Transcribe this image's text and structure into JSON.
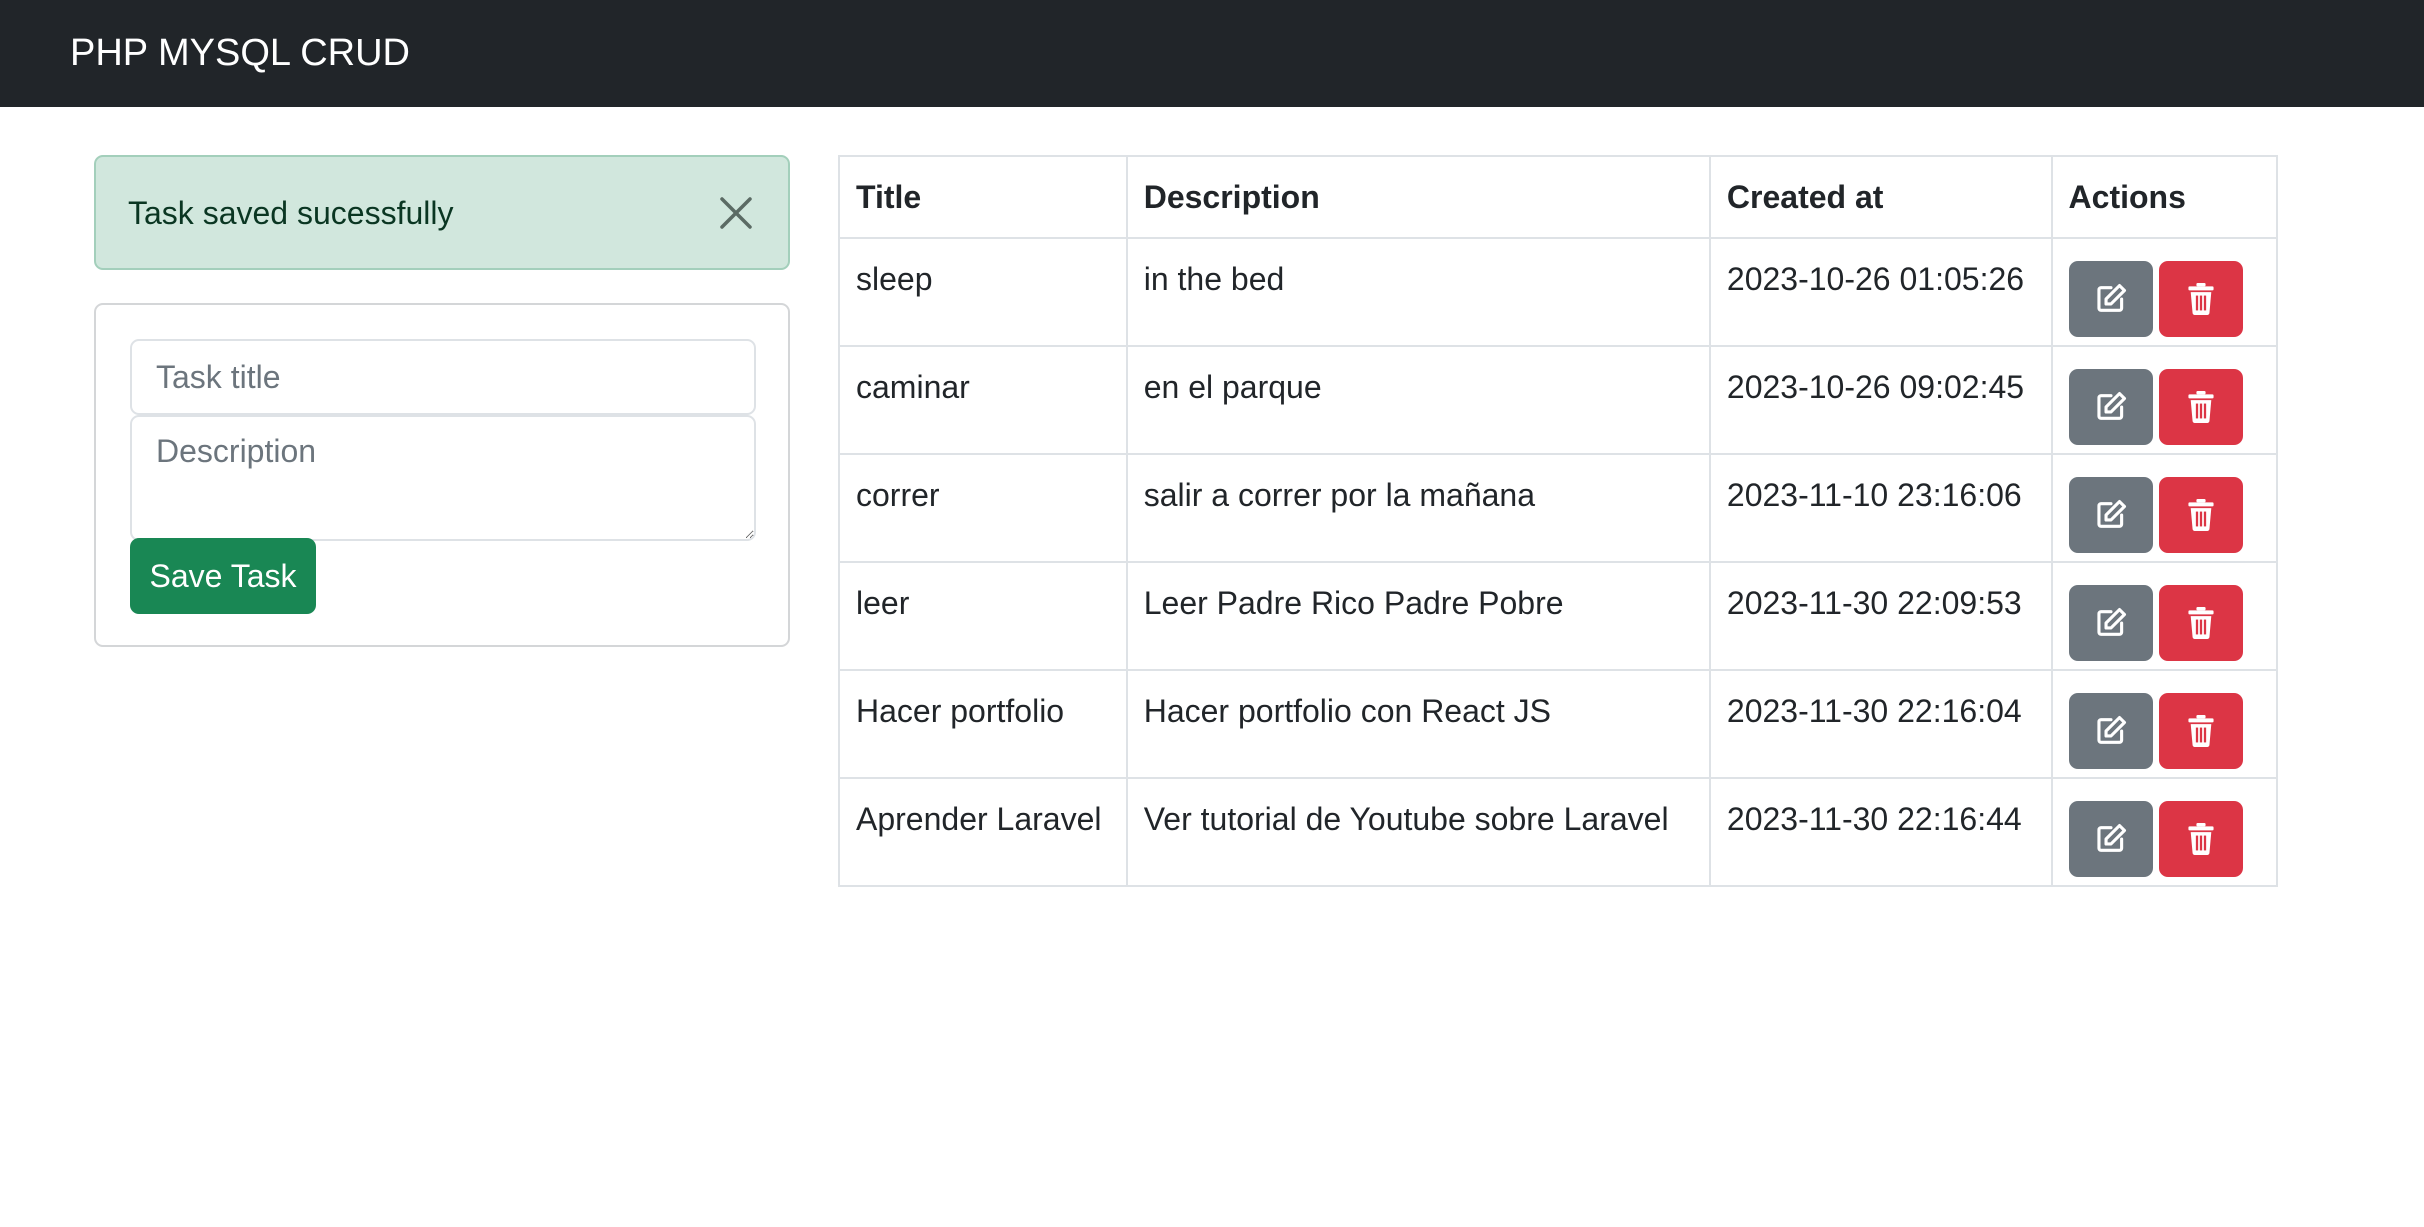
{
  "navbar": {
    "brand": "PHP MYSQL CRUD"
  },
  "alert": {
    "message": "Task saved sucessfully",
    "close_icon": "close-icon",
    "color": "#d1e7dd"
  },
  "form": {
    "title_placeholder": "Task title",
    "title_value": "",
    "description_placeholder": "Description",
    "description_value": "",
    "save_label": "Save Task",
    "save_color": "#198754"
  },
  "table": {
    "headers": {
      "title": "Title",
      "description": "Description",
      "created_at": "Created at",
      "actions": "Actions"
    },
    "rows": [
      {
        "title": "sleep",
        "description": "in the bed",
        "created_at": "2023-10-26 01:05:26"
      },
      {
        "title": "caminar",
        "description": "en el parque",
        "created_at": "2023-10-26 09:02:45"
      },
      {
        "title": "correr",
        "description": "salir a correr por la mañana",
        "created_at": "2023-11-10 23:16:06"
      },
      {
        "title": "leer",
        "description": "Leer Padre Rico Padre Pobre",
        "created_at": "2023-11-30 22:09:53"
      },
      {
        "title": "Hacer portfolio",
        "description": "Hacer portfolio con React JS",
        "created_at": "2023-11-30 22:16:04"
      },
      {
        "title": "Aprender Laravel",
        "description": "Ver tutorial de Youtube sobre Laravel",
        "created_at": "2023-11-30 22:16:44"
      }
    ],
    "edit_icon": "edit-icon",
    "delete_icon": "trash-icon",
    "edit_color": "#6c757d",
    "delete_color": "#dc3545"
  }
}
